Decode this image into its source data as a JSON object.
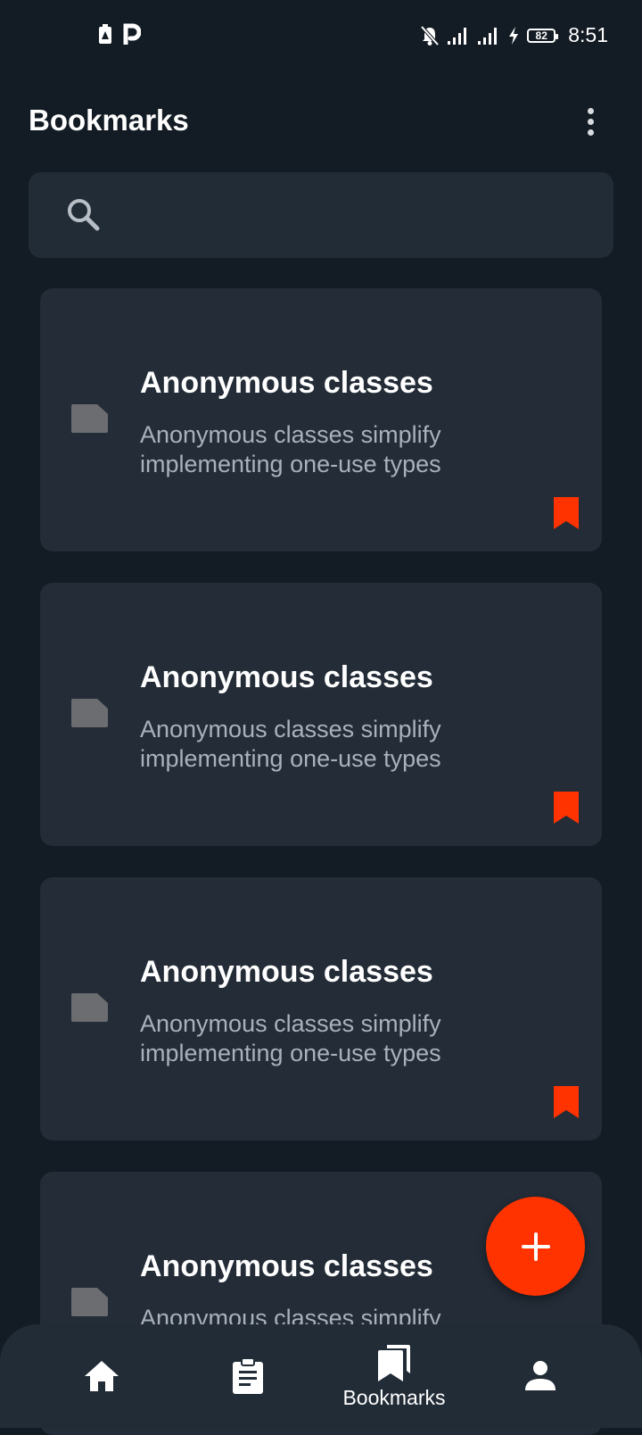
{
  "status_bar": {
    "time": "8:51",
    "battery": "82"
  },
  "header": {
    "title": "Bookmarks"
  },
  "search": {
    "placeholder": "",
    "value": ""
  },
  "bookmarks": [
    {
      "title": "Anonymous classes",
      "description": "Anonymous classes simplify implementing one-use types"
    },
    {
      "title": "Anonymous classes",
      "description": "Anonymous classes simplify implementing one-use types"
    },
    {
      "title": "Anonymous classes",
      "description": "Anonymous classes simplify implementing one-use types"
    },
    {
      "title": "Anonymous classes",
      "description": "Anonymous classes simplify implementing one-use types"
    }
  ],
  "bottom_nav": {
    "items": [
      {
        "icon": "home-icon",
        "label": ""
      },
      {
        "icon": "clipboard-icon",
        "label": ""
      },
      {
        "icon": "bookmarks-icon",
        "label": "Bookmarks"
      },
      {
        "icon": "person-icon",
        "label": ""
      }
    ]
  },
  "colors": {
    "background": "#131c24",
    "surface": "#232c37",
    "accent": "#ff3300",
    "secondary_text": "#a9b1bb"
  }
}
